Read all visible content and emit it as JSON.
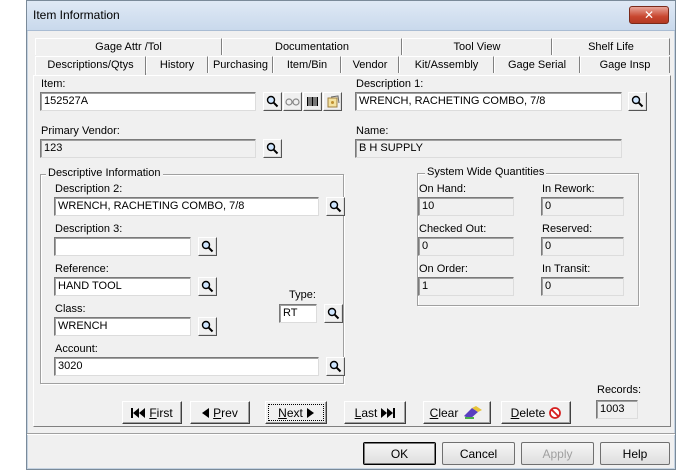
{
  "window": {
    "title": "Item Information",
    "close_glyph": "✕"
  },
  "tabs_back": [
    "Gage Attr /Tol",
    "Documentation",
    "Tool View",
    "Shelf Life"
  ],
  "tabs_front": [
    "Descriptions/Qtys",
    "History",
    "Purchasing",
    "Item/Bin",
    "Vendor",
    "Kit/Assembly",
    "Gage Serial",
    "Gage Insp"
  ],
  "active_tab": "Descriptions/Qtys",
  "item": {
    "label": "Item:",
    "value": "152527A"
  },
  "description1": {
    "label": "Description 1:",
    "value": "WRENCH, RACHETING COMBO, 7/8"
  },
  "primary_vendor": {
    "label": "Primary Vendor:",
    "value": "123"
  },
  "name": {
    "label": "Name:",
    "value": "B H SUPPLY"
  },
  "descriptive": {
    "title": "Descriptive Information",
    "description2": {
      "label": "Description 2:",
      "value": "WRENCH, RACHETING COMBO, 7/8"
    },
    "description3": {
      "label": "Description 3:",
      "value": ""
    },
    "reference": {
      "label": "Reference:",
      "value": "HAND TOOL"
    },
    "class": {
      "label": "Class:",
      "value": "WRENCH"
    },
    "type": {
      "label": "Type:",
      "value": "RT"
    },
    "account": {
      "label": "Account:",
      "value": "3020"
    }
  },
  "quantities": {
    "title": "System Wide Quantities",
    "on_hand": {
      "label": "On Hand:",
      "value": "10"
    },
    "in_rework": {
      "label": "In Rework:",
      "value": "0"
    },
    "checked_out": {
      "label": "Checked Out:",
      "value": "0"
    },
    "reserved": {
      "label": "Reserved:",
      "value": "0"
    },
    "on_order": {
      "label": "On Order:",
      "value": "1"
    },
    "in_transit": {
      "label": "In Transit:",
      "value": "0"
    }
  },
  "records": {
    "label": "Records:",
    "value": "1003"
  },
  "nav": {
    "first_key": "F",
    "first_rest": "irst",
    "prev_key": "P",
    "prev_rest": "rev",
    "next_key": "N",
    "next_rest": "ext",
    "last_key": "L",
    "last_rest": "ast",
    "clear_key": "C",
    "clear_rest": "lear",
    "delete_key": "D",
    "delete_rest": "elete"
  },
  "footer": {
    "ok": "OK",
    "cancel": "Cancel",
    "apply": "Apply",
    "help": "Help"
  },
  "icons": {
    "magnifier": "magnifier-icon",
    "glasses": "glasses-icon",
    "barcode": "barcode-icon",
    "notes": "notes-icon",
    "first": "first-record-icon",
    "prev": "prev-record-icon",
    "next": "next-record-icon",
    "last": "last-record-icon",
    "eraser": "eraser-icon",
    "delete": "no-entry-icon"
  },
  "colors": {
    "titlebar": "#c9d9ec",
    "close": "#c8462f",
    "face": "#f0f0f0"
  }
}
